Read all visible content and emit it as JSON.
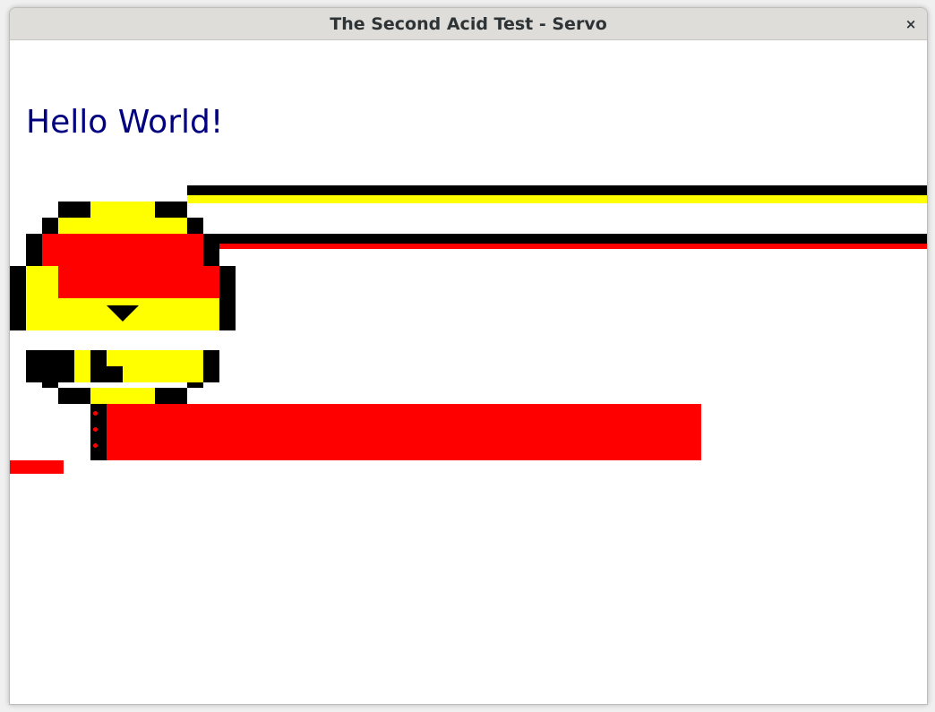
{
  "window": {
    "title": "The Second Acid Test - Servo",
    "close_glyph": "×"
  },
  "page": {
    "heading": "Hello World!"
  },
  "colors": {
    "text": "#000080",
    "face": "#ffff00",
    "outline": "#000000",
    "error": "#ff0000",
    "background": "#ffffff"
  }
}
